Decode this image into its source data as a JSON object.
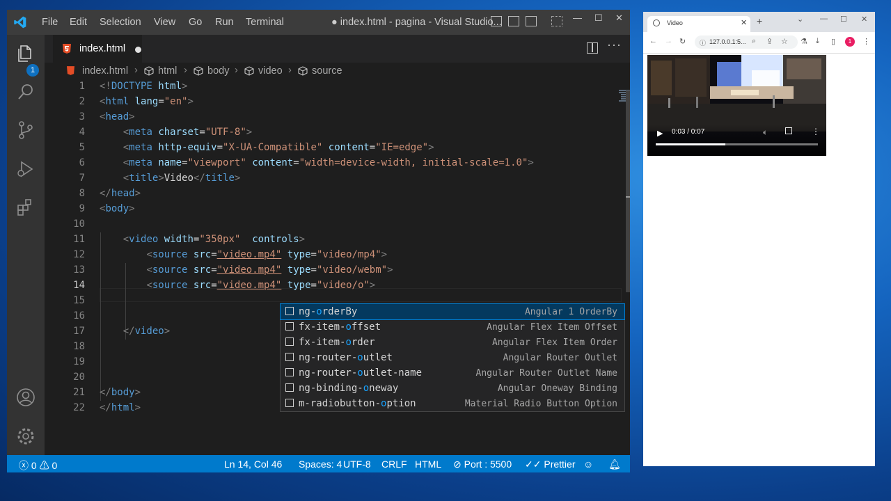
{
  "vscode": {
    "menu": [
      "File",
      "Edit",
      "Selection",
      "View",
      "Go",
      "Run",
      "Terminal"
    ],
    "title": "● index.html - pagina - Visual Studio...",
    "window_controls": [
      "—",
      "☐",
      "✕"
    ],
    "activity_badge": "1",
    "tab": {
      "label": "index.html"
    },
    "breadcrumb": [
      "index.html",
      "html",
      "body",
      "video",
      "source"
    ],
    "line_numbers": [
      "1",
      "2",
      "3",
      "4",
      "5",
      "6",
      "7",
      "8",
      "9",
      "10",
      "11",
      "12",
      "13",
      "14",
      "15",
      "16",
      "17",
      "18",
      "19",
      "20",
      "21",
      "22"
    ],
    "current_line": "14",
    "code": {
      "l1": {
        "open": "<!",
        "tag": "DOCTYPE",
        "rest": " html",
        "close": ">"
      },
      "l2": {
        "tag": "html",
        "attr": "lang",
        "val": "\"en\""
      },
      "l3": {
        "tag": "head"
      },
      "l4": {
        "tag": "meta",
        "attr": "charset",
        "val": "\"UTF-8\""
      },
      "l5": {
        "tag": "meta",
        "attr1": "http-equiv",
        "val1": "\"X-UA-Compatible\"",
        "attr2": "content",
        "val2": "\"IE=edge\""
      },
      "l6": {
        "tag": "meta",
        "attr1": "name",
        "val1": "\"viewport\"",
        "attr2": "content",
        "val2": "\"width=device-width, initial-scale=1.0\""
      },
      "l7": {
        "tag": "title",
        "text": "Video"
      },
      "l8": {
        "tag": "head"
      },
      "l9": {
        "tag": "body"
      },
      "l11": {
        "tag": "video",
        "attr1": "width",
        "val1": "\"350px\"",
        "attr2": "controls"
      },
      "l12": {
        "tag": "source",
        "attr1": "src",
        "val1": "\"video.mp4\"",
        "attr2": "type",
        "val2": "\"video/mp4\""
      },
      "l13": {
        "tag": "source",
        "attr1": "src",
        "val1": "\"video.mp4\"",
        "attr2": "type",
        "val2": "\"video/webm\""
      },
      "l14": {
        "tag": "source",
        "attr1": "src",
        "val1": "\"video.mp4\"",
        "attr2": "type",
        "val2": "\"video/o\""
      },
      "l17": {
        "tag": "video"
      },
      "l21": {
        "tag": "body"
      },
      "l22": {
        "tag": "html"
      }
    },
    "suggestions": [
      {
        "pre": "ng-",
        "hl": "o",
        "post": "rderBy",
        "detail": "Angular 1 OrderBy"
      },
      {
        "pre": "fx-item-",
        "hl": "o",
        "post": "ffset",
        "detail": "Angular Flex Item Offset"
      },
      {
        "pre": "fx-item-",
        "hl": "o",
        "post": "rder",
        "detail": "Angular Flex Item Order"
      },
      {
        "pre": "ng-router-",
        "hl": "o",
        "post": "utlet",
        "detail": "Angular Router Outlet"
      },
      {
        "pre": "ng-router-",
        "hl": "o",
        "post": "utlet-name",
        "detail": "Angular Router Outlet Name"
      },
      {
        "pre": "ng-binding-",
        "hl": "o",
        "post": "neway",
        "detail": "Angular Oneway Binding"
      },
      {
        "pre": "m-radiobutton-",
        "hl": "o",
        "post": "ption",
        "detail": "Material Radio Button Option"
      }
    ],
    "status": {
      "errors": "0",
      "warnings": "0",
      "position": "Ln 14, Col 46",
      "spaces": "Spaces: 4",
      "encoding": "UTF-8",
      "eol": "CRLF",
      "language": "HTML",
      "port": "Port : 5500",
      "prettier": "Prettier"
    },
    "colors": {
      "statusbar": "#007acc",
      "titlebar": "#3c3c3c",
      "editor": "#1e1e1e",
      "activity": "#333333"
    }
  },
  "browser": {
    "tab_title": "Video",
    "new_tab": "+",
    "url": "127.0.0.1:5...",
    "avatar": "1",
    "video": {
      "time": "0:03 / 0:07",
      "progress": 0.43
    }
  }
}
